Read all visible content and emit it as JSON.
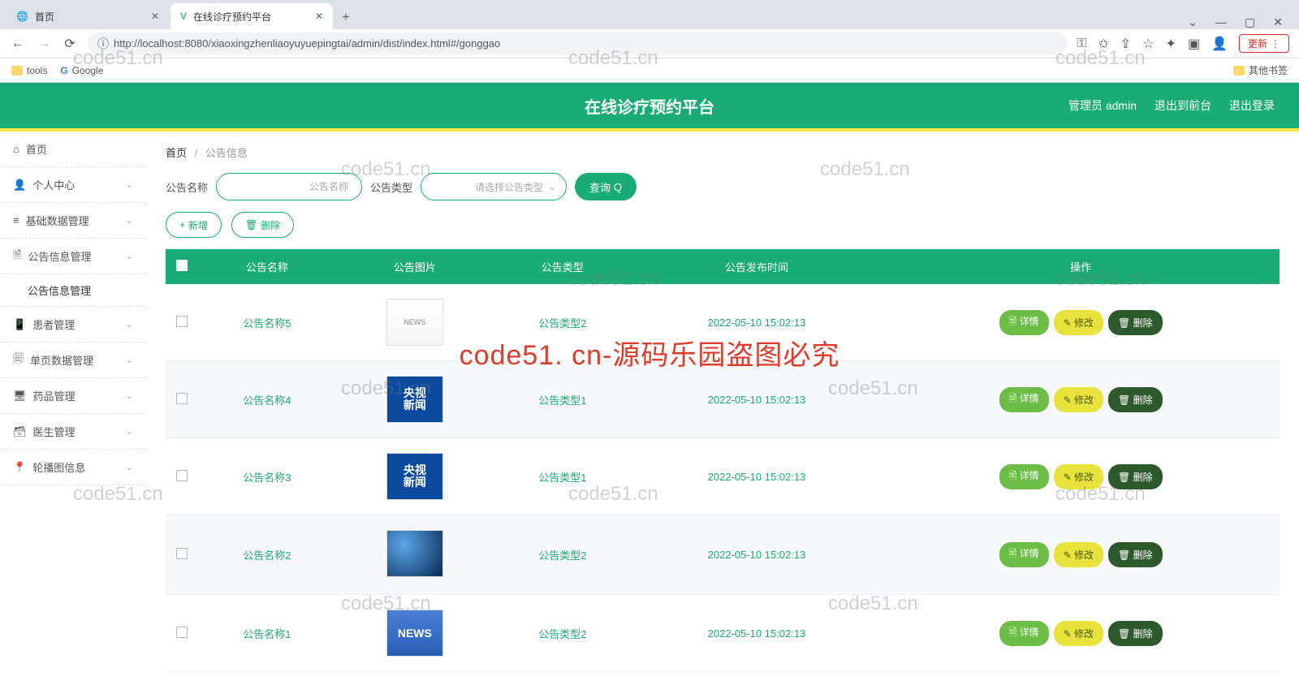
{
  "browser": {
    "tabs": [
      {
        "title": "首页",
        "active": false
      },
      {
        "title": "在线诊疗预约平台",
        "active": true
      }
    ],
    "url": "http://localhost:8080/xiaoxingzhenliaoyuyuepingtai/admin/dist/index.html#/gonggao",
    "update_label": "更新",
    "bookmarks": {
      "tools": "tools",
      "google": "Google",
      "other": "其他书签"
    }
  },
  "header": {
    "title": "在线诊疗预约平台",
    "admin_label": "管理员 admin",
    "front_label": "退出到前台",
    "logout_label": "退出登录"
  },
  "sidebar": {
    "items": [
      {
        "icon": "⌂",
        "label": "首页",
        "expandable": false
      },
      {
        "icon": "👤",
        "label": "个人中心",
        "expandable": true
      },
      {
        "icon": "≡",
        "label": "基础数据管理",
        "expandable": true
      },
      {
        "icon": "🗎",
        "label": "公告信息管理",
        "expandable": true
      },
      {
        "icon": "📱",
        "label": "患者管理",
        "expandable": true
      },
      {
        "icon": "🗐",
        "label": "单页数据管理",
        "expandable": true
      },
      {
        "icon": "🖥",
        "label": "药品管理",
        "expandable": true
      },
      {
        "icon": "🗃",
        "label": "医生管理",
        "expandable": true
      },
      {
        "icon": "📍",
        "label": "轮播图信息",
        "expandable": true
      }
    ],
    "sub_item": "公告信息管理"
  },
  "breadcrumb": {
    "home": "首页",
    "current": "公告信息"
  },
  "filters": {
    "name_label": "公告名称",
    "name_placeholder": "公告名称",
    "type_label": "公告类型",
    "type_placeholder": "请选择公告类型",
    "search_btn": "查询"
  },
  "toolbar": {
    "add_btn": "新增",
    "del_btn": "删除"
  },
  "table": {
    "headers": [
      "",
      "公告名称",
      "公告图片",
      "公告类型",
      "公告发布时间",
      "操作"
    ],
    "rows": [
      {
        "name": "公告名称5",
        "img": "news1",
        "type": "公告类型2",
        "time": "2022-05-10 15:02:13"
      },
      {
        "name": "公告名称4",
        "img": "cctv",
        "type": "公告类型1",
        "time": "2022-05-10 15:02:13"
      },
      {
        "name": "公告名称3",
        "img": "cctv",
        "type": "公告类型1",
        "time": "2022-05-10 15:02:13"
      },
      {
        "name": "公告名称2",
        "img": "globe",
        "type": "公告类型2",
        "time": "2022-05-10 15:02:13"
      },
      {
        "name": "公告名称1",
        "img": "newslogo",
        "type": "公告类型2",
        "time": "2022-05-10 15:02:13"
      }
    ],
    "op_detail": "详情",
    "op_edit": "修改",
    "op_delete": "删除"
  },
  "watermark": {
    "text": "code51.cn",
    "center": "code51. cn-源码乐园盗图必究"
  },
  "icons": {
    "back": "←",
    "forward": "→",
    "reload": "⟳",
    "info": "ⓘ",
    "key": "⚿",
    "star_add": "✩",
    "share": "⇪",
    "star": "☆",
    "ext": "✦",
    "panel": "▣",
    "user": "👤",
    "min": "—",
    "max": "▢",
    "close_w": "✕",
    "dropdown": "⌄",
    "plus": "+",
    "trash": "🗑",
    "search": "Q",
    "doc": "🗎",
    "edit": "✎"
  }
}
